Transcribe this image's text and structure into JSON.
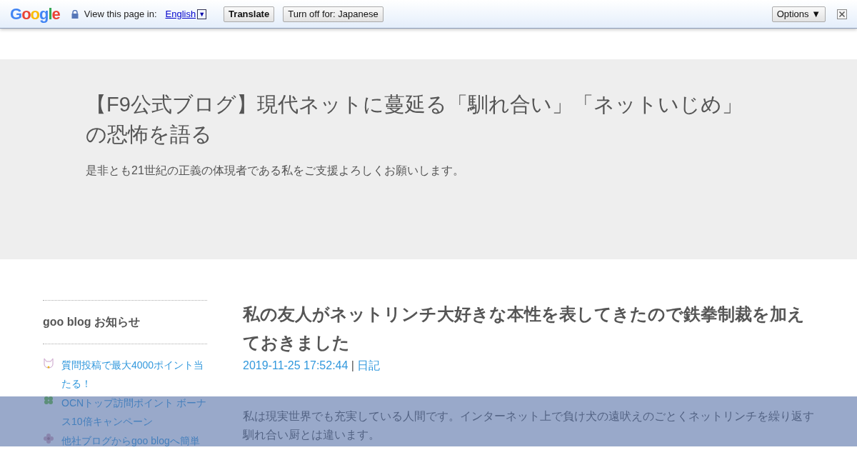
{
  "translate_bar": {
    "logo": "Google",
    "prompt": "View this page in:",
    "language": "English",
    "language_caret": "▼",
    "translate_button": "Translate",
    "turn_off_button": "Turn off for: Japanese",
    "options_button": "Options",
    "options_caret": "▼"
  },
  "blog_header": {
    "title": "【F9公式ブログ】現代ネットに蔓延る「馴れ合い」「ネットいじめ」の恐怖を語る",
    "tagline": "是非とも21世紀の正義の体現者である私をご支援よろしくお願いします。"
  },
  "sidebar": {
    "heading": "goo blog お知らせ",
    "items": [
      {
        "kind": "cat",
        "text": "質問投稿で最大4000ポイント当たる！"
      },
      {
        "kind": "clover",
        "text": "OCNトップ訪問ポイント ボーナス10倍キャンペーン"
      },
      {
        "kind": "flower",
        "text": "他社ブログからgoo blogへ簡単"
      }
    ]
  },
  "post": {
    "title": "私の友人がネットリンチ大好きな本性を表してきたので鉄拳制裁を加えておきました",
    "date": "2019-11-25 17:52:44",
    "separator": "|",
    "category": "日記",
    "body": "私は現実世界でも充実している人間です。インターネット上で負け犬の遠吠えのごとくネットリンチを繰り返す馴れ合い厨とは違います。"
  }
}
